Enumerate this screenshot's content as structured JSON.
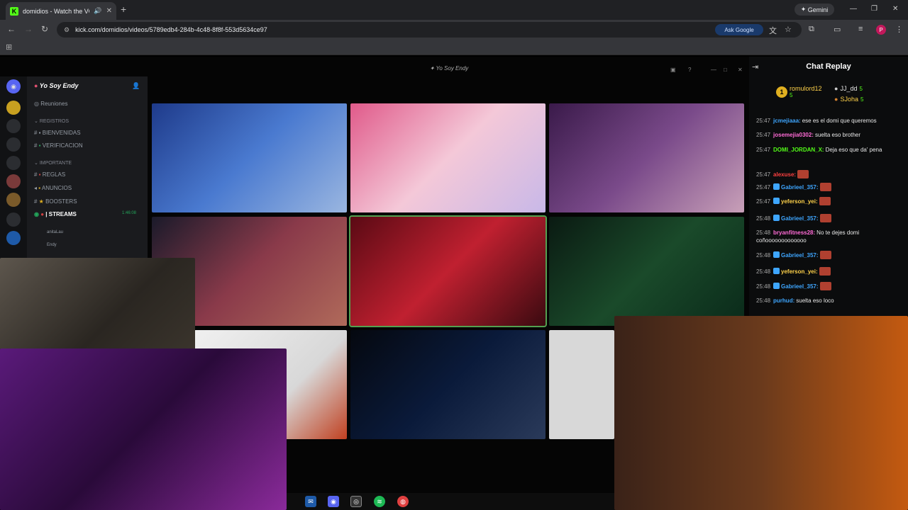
{
  "browser": {
    "tab_title": "domidios - Watch the VOD",
    "tab_favicon": "K",
    "new_tab": "+",
    "gemini_label": "Gemini",
    "url": "kick.com/domidios/videos/5789edb4-284b-4c48-8f8f-553d5634ce97",
    "ask_google": "Ask Google",
    "profile_initial": "P"
  },
  "discord": {
    "window_title": "Yo Soy Endy",
    "server_name": "Yo Soy Endy",
    "items": [
      {
        "label": "Reuniones"
      },
      {
        "label": "REGISTROS"
      },
      {
        "label": "BIENVENIDAS"
      },
      {
        "label": "VERIFICACION"
      },
      {
        "label": "IMPORTANTE"
      },
      {
        "label": "REGLAS"
      },
      {
        "label": "ANUNCIOS"
      },
      {
        "label": "BOOSTERS"
      },
      {
        "label": "STREAMS"
      }
    ],
    "live_time": "1:46:08",
    "voice_users": [
      {
        "label": "anitaLau"
      },
      {
        "label": "Endy"
      }
    ]
  },
  "chat": {
    "title": "Chat Replay",
    "gifters": [
      {
        "rank": "1",
        "name": "romulord12",
        "count": "5"
      },
      {
        "rank": "",
        "name": "JJ_dd",
        "count": "5"
      },
      {
        "rank": "",
        "name": "SJoha",
        "count": "5"
      }
    ],
    "messages": [
      {
        "time": "25:47",
        "user": "jcmejiaaa:",
        "text": "ese es el domi que queremos",
        "color": "#3ea6ff"
      },
      {
        "time": "25:47",
        "user": "josemejia0302:",
        "text": "suelta eso brother",
        "color": "#ff6bd6"
      },
      {
        "time": "25:47",
        "user": "DOMI_JORDAN_X:",
        "text": "Deja eso que da' pena",
        "color": "#53fc18"
      },
      {
        "time": "25:47",
        "user": "alexuse:",
        "text": "",
        "color": "#ff4040"
      },
      {
        "time": "25:47",
        "user": "Gabrieel_357:",
        "text": "",
        "color": "#3ea6ff"
      },
      {
        "time": "25:47",
        "user": "yeferson_yei:",
        "text": "",
        "color": "#ffd24a"
      },
      {
        "time": "25:48",
        "user": "Gabrieel_357:",
        "text": "",
        "color": "#3ea6ff"
      },
      {
        "time": "25:48",
        "user": "bryanfitness28:",
        "text": "No te dejes domi coñooooooooooooo",
        "color": "#ff6bd6"
      },
      {
        "time": "25:48",
        "user": "Gabrieel_357:",
        "text": "",
        "color": "#3ea6ff"
      },
      {
        "time": "25:48",
        "user": "yeferson_yei:",
        "text": "",
        "color": "#ffd24a"
      },
      {
        "time": "25:48",
        "user": "Gabrieel_357:",
        "text": "",
        "color": "#3ea6ff"
      },
      {
        "time": "25:48",
        "user": "purhud:",
        "text": "suelta eso loco",
        "color": "#3ea6ff"
      }
    ]
  },
  "colors": {
    "kick_green": "#53fc18",
    "chat_bg": "#0b0c0d"
  }
}
